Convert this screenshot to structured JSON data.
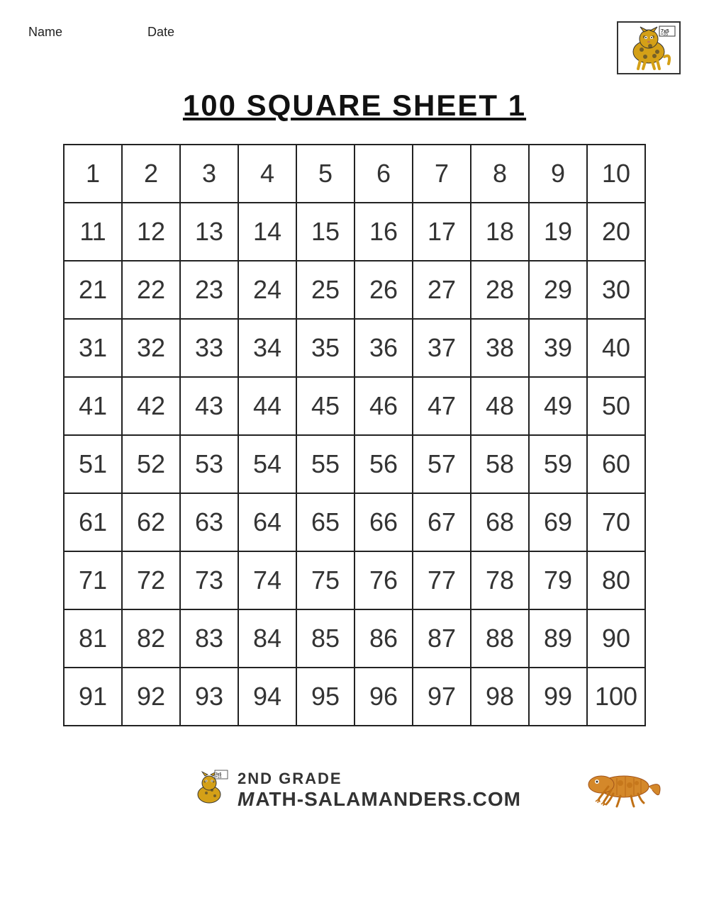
{
  "header": {
    "name_label": "Name",
    "date_label": "Date"
  },
  "title": "100 SQUARE SHEET 1",
  "grid": {
    "numbers": [
      [
        1,
        2,
        3,
        4,
        5,
        6,
        7,
        8,
        9,
        10
      ],
      [
        11,
        12,
        13,
        14,
        15,
        16,
        17,
        18,
        19,
        20
      ],
      [
        21,
        22,
        23,
        24,
        25,
        26,
        27,
        28,
        29,
        30
      ],
      [
        31,
        32,
        33,
        34,
        35,
        36,
        37,
        38,
        39,
        40
      ],
      [
        41,
        42,
        43,
        44,
        45,
        46,
        47,
        48,
        49,
        50
      ],
      [
        51,
        52,
        53,
        54,
        55,
        56,
        57,
        58,
        59,
        60
      ],
      [
        61,
        62,
        63,
        64,
        65,
        66,
        67,
        68,
        69,
        70
      ],
      [
        71,
        72,
        73,
        74,
        75,
        76,
        77,
        78,
        79,
        80
      ],
      [
        81,
        82,
        83,
        84,
        85,
        86,
        87,
        88,
        89,
        90
      ],
      [
        91,
        92,
        93,
        94,
        95,
        96,
        97,
        98,
        99,
        100
      ]
    ]
  },
  "footer": {
    "grade": "2ND GRADE",
    "site": "ATH-SALAMANDERS.COM",
    "site_prefix": "M"
  }
}
